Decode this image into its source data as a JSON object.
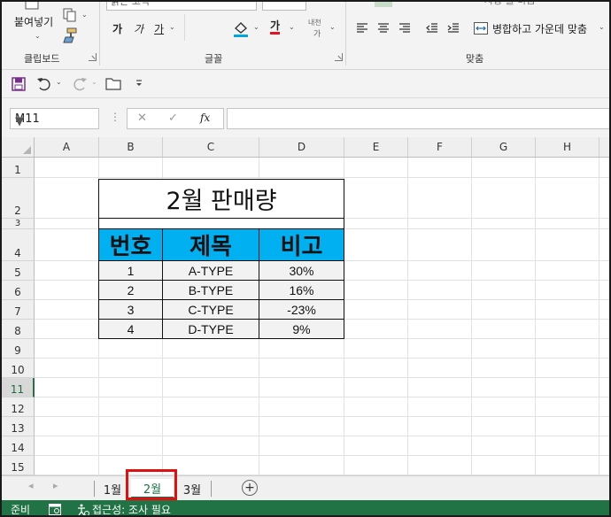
{
  "ribbon": {
    "paste_label": "붙여넣기",
    "font_name": "맑은 고딕",
    "bold_glyph": "가",
    "italic_glyph": "가",
    "underline_glyph": "가",
    "font_color_glyph": "가",
    "phonetic_glyph_top": "내천",
    "phonetic_glyph_bottom": "가",
    "merge_label": "병합하고 가운데 맞춤",
    "wrap_label": "자동 줄 바꿈",
    "groups": {
      "clipboard": "클립보드",
      "font": "글꼴",
      "align": "맞춤"
    },
    "colors": {
      "fill": "#00a6e0",
      "font": "#e81123"
    }
  },
  "formula_bar": {
    "name_box": "M11",
    "fx": "fx",
    "cancel_glyph": "✕",
    "enter_glyph": "✓",
    "formula": ""
  },
  "grid": {
    "columns": [
      "A",
      "B",
      "C",
      "D",
      "E",
      "F",
      "G",
      "H"
    ],
    "rows": [
      "1",
      "2",
      "3",
      "4",
      "5",
      "6",
      "7",
      "8",
      "9",
      "10",
      "11",
      "12",
      "13",
      "14",
      "15"
    ],
    "selected_row": "11"
  },
  "table": {
    "title": "2월 판매량",
    "headers": [
      "번호",
      "제목",
      "비고"
    ],
    "rows": [
      [
        "1",
        "A-TYPE",
        "30%"
      ],
      [
        "2",
        "B-TYPE",
        "16%"
      ],
      [
        "3",
        "C-TYPE",
        "-23%"
      ],
      [
        "4",
        "D-TYPE",
        "9%"
      ]
    ],
    "colors": {
      "header_bg": "#00b0f0",
      "body_bg": "#f2f2f2"
    }
  },
  "sheets": {
    "tabs": [
      "1월",
      "2월",
      "3월"
    ],
    "active": "2월",
    "add_glyph": "+"
  },
  "status": {
    "ready": "준비",
    "accessibility": "접근성: 조사 필요"
  }
}
